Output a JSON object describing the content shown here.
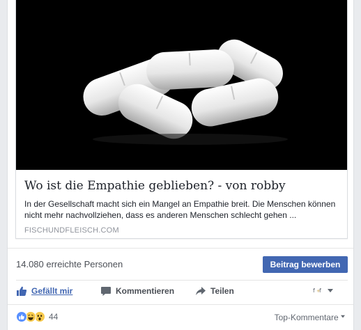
{
  "link": {
    "title": "Wo ist die Empathie geblieben? - von robby",
    "description": "In der Gesellschaft macht sich ein Mangel an Empathie breit. Die Menschen können nicht mehr nachvollziehen, dass es anderen Menschen schlecht gehen ...",
    "domain": "FISCHUNDFLEISCH.COM",
    "image_subject": "white-pills-on-black"
  },
  "insights": {
    "reach": "14.080 erreichte Personen",
    "promote_label": "Beitrag bewerben"
  },
  "actions": {
    "like_label": "Gefällt mir",
    "comment_label": "Kommentieren",
    "share_label": "Teilen"
  },
  "reactions": {
    "count": "44",
    "types": [
      "like-icon",
      "haha-icon",
      "wow-icon"
    ],
    "sort_label": "Top-Kommentare"
  },
  "colors": {
    "brand": "#4267b2",
    "like_blue": "#5890ff",
    "emoji_yellow": "#f7c94b",
    "background": "#e9ebee"
  }
}
